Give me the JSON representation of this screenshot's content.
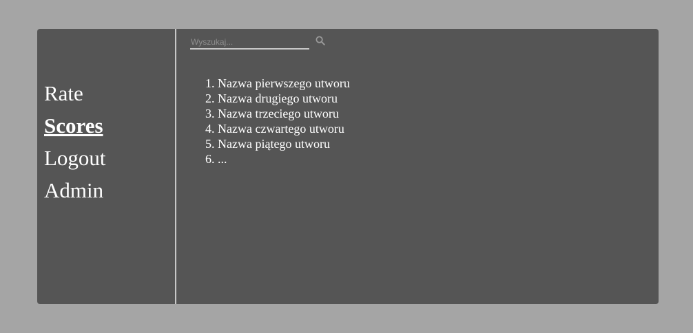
{
  "nav": {
    "items": [
      {
        "label": "Rate",
        "active": false
      },
      {
        "label": "Scores",
        "active": true
      },
      {
        "label": "Logout",
        "active": false
      },
      {
        "label": "Admin",
        "active": false
      }
    ]
  },
  "search": {
    "placeholder": "Wyszukaj...",
    "value": "",
    "icon": "search-icon"
  },
  "songs": [
    "Nazwa pierwszego utworu",
    "Nazwa drugiego utworu",
    "Nazwa trzeciego utworu",
    "Nazwa czwartego utworu",
    "Nazwa piątego utworu",
    "..."
  ],
  "colors": {
    "background": "#a5a5a5",
    "panel": "#555555",
    "divider": "#c8c8c8",
    "text": "#ffffff",
    "placeholder": "#8e8e8e"
  }
}
